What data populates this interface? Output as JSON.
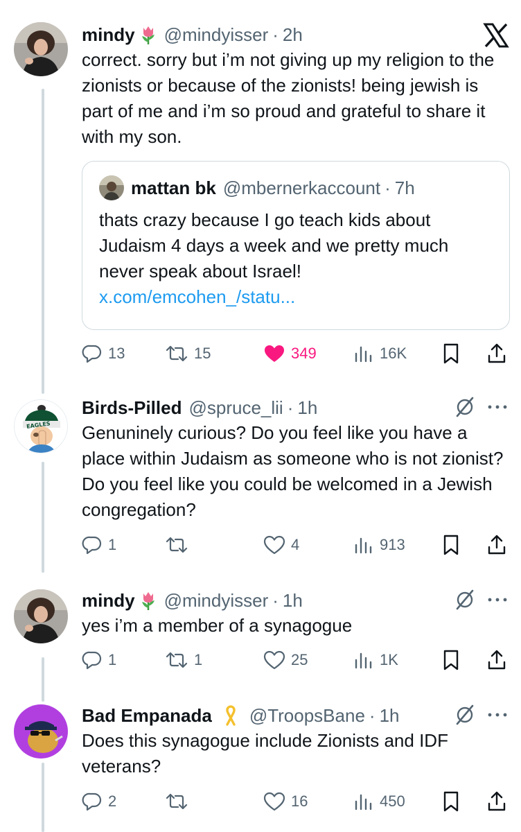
{
  "icons": {
    "logo": "x-logo-icon",
    "grok": "grok-icon",
    "more": "more-icon"
  },
  "colors": {
    "text": "#0f1419",
    "secondary": "#536471",
    "link": "#1d9bf0",
    "like": "#f91880",
    "border": "#cfd9de"
  },
  "tweets": [
    {
      "name": "mindy",
      "emoji": "tulip",
      "handle": "@mindyisser",
      "time": "2h",
      "text": "correct. sorry but i’m not giving up my religion to the zionists or because of the zionists! being jewish is part of me and i’m so proud and grateful to share it with my son.",
      "quote": {
        "name": "mattan bk",
        "handle": "@mbernerkaccount",
        "time": "7h",
        "text": "thats crazy because I go teach kids about Judaism 4 days a week and we pretty much never speak about Israel! ",
        "link": "x.com/emcohen_/statu..."
      },
      "stats": {
        "replies": "13",
        "reposts": "15",
        "likes": "349",
        "views": "16K",
        "liked": true
      }
    },
    {
      "name": "Birds-Pilled",
      "handle": "@spruce_lii",
      "time": "1h",
      "text": "Genuninely curious? Do you feel like you have a place within Judaism as someone who is not zionist? Do you feel like you could be welcomed in a Jewish congregation?",
      "avatar_text": "EAGLES",
      "stats": {
        "replies": "1",
        "reposts": "",
        "likes": "4",
        "views": "913",
        "liked": false
      }
    },
    {
      "name": "mindy",
      "emoji": "tulip",
      "handle": "@mindyisser",
      "time": "1h",
      "text": "yes i’m a member of a synagogue",
      "stats": {
        "replies": "1",
        "reposts": "1",
        "likes": "25",
        "views": "1K",
        "liked": false
      }
    },
    {
      "name": "Bad Empanada",
      "emoji": "yellow-ribbon",
      "handle": "@TroopsBane",
      "time": "1h",
      "text": "Does this synagogue include Zionists and IDF veterans?",
      "stats": {
        "replies": "2",
        "reposts": "",
        "likes": "16",
        "views": "450",
        "liked": false
      }
    }
  ]
}
